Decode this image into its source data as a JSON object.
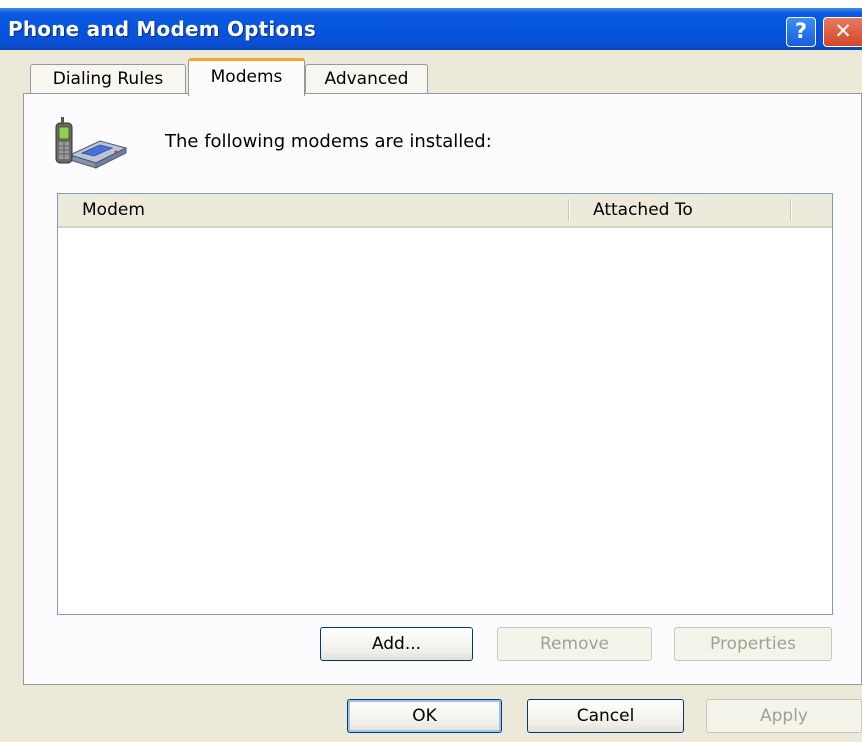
{
  "window": {
    "title": "Phone and Modem Options",
    "help_glyph": "?",
    "close_glyph": "✕"
  },
  "tabs": [
    {
      "label": "Dialing Rules",
      "selected": false
    },
    {
      "label": "Modems",
      "selected": true
    },
    {
      "label": "Advanced",
      "selected": false
    }
  ],
  "modems_page": {
    "icon": "phone-modem-icon",
    "info_text": "The following modems are  installed:",
    "list": {
      "columns": [
        "Modem",
        "Attached To"
      ],
      "rows": []
    },
    "buttons": {
      "add": "Add...",
      "remove": "Remove",
      "properties": "Properties"
    }
  },
  "dialog_buttons": {
    "ok": "OK",
    "cancel": "Cancel",
    "apply": "Apply"
  },
  "colors": {
    "titlebar": "#0654dd",
    "dialog_face": "#ece9d8",
    "selected_tab_accent": "#f5a623",
    "close_button": "#d2472a"
  }
}
